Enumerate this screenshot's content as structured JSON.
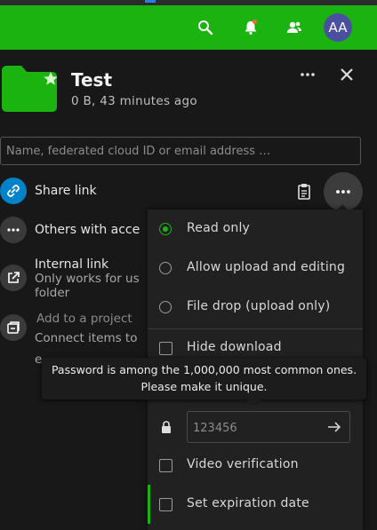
{
  "header": {
    "avatar_initials": "AA",
    "icons": [
      "search-icon",
      "notifications-icon",
      "contacts-icon"
    ]
  },
  "sidebar": {
    "title": "Test",
    "subtitle": "0 B, 43 minutes ago",
    "share_placeholder": "Name, federated cloud ID or email address …"
  },
  "rows": {
    "share_link": "Share link",
    "others_access": "Others with acce",
    "internal_link": "Internal link",
    "internal_sub1": "Only works for us",
    "internal_sub2": "folder",
    "add_project": "Add to a project",
    "project_sub1": "Connect items to",
    "project_sub2": "e"
  },
  "menu": {
    "read_only": "Read only",
    "allow_upload": "Allow upload and editing",
    "file_drop": "File drop (upload only)",
    "hide_download": "Hide download",
    "password_value": "123456",
    "video_verification": "Video verification",
    "set_expiration": "Set expiration date"
  },
  "tooltip": {
    "line1": "Password is among the 1,000,000 most common ones.",
    "line2": "Please make it unique."
  },
  "colors": {
    "brand": "#1ab30f",
    "link_blue": "#0082c9",
    "avatar": "#4a4f9f"
  }
}
